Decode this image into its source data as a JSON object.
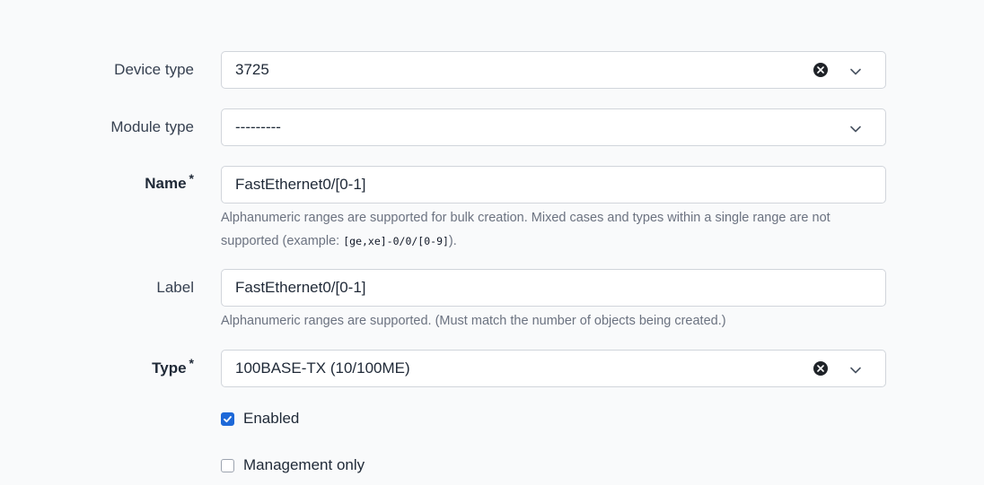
{
  "fields": {
    "device_type": {
      "label": "Device type",
      "value": "3725",
      "clearable": true
    },
    "module_type": {
      "label": "Module type",
      "value": "---------",
      "clearable": false
    },
    "name": {
      "label": "Name",
      "required_mark": "*",
      "value": "FastEthernet0/[0-1]",
      "help_prefix": "Alphanumeric ranges are supported for bulk creation. Mixed cases and types within a single range are not supported (example: ",
      "help_code": "[ge,xe]-0/0/[0-9]",
      "help_suffix": ")."
    },
    "label": {
      "label": "Label",
      "value": "FastEthernet0/[0-1]",
      "help": "Alphanumeric ranges are supported. (Must match the number of objects being created.)"
    },
    "type": {
      "label": "Type",
      "required_mark": "*",
      "value": "100BASE-TX (10/100ME)",
      "clearable": true
    },
    "enabled": {
      "label": "Enabled",
      "checked": true
    },
    "mgmt_only": {
      "label": "Management only",
      "checked": false
    }
  },
  "colors": {
    "accent": "#1d68d8",
    "background": "#f9fafb",
    "border": "#d1d5db",
    "help_text": "#6b7280"
  },
  "icons": {
    "clear": "x-circle-icon",
    "dropdown": "chevron-down-icon",
    "check": "check-icon"
  }
}
